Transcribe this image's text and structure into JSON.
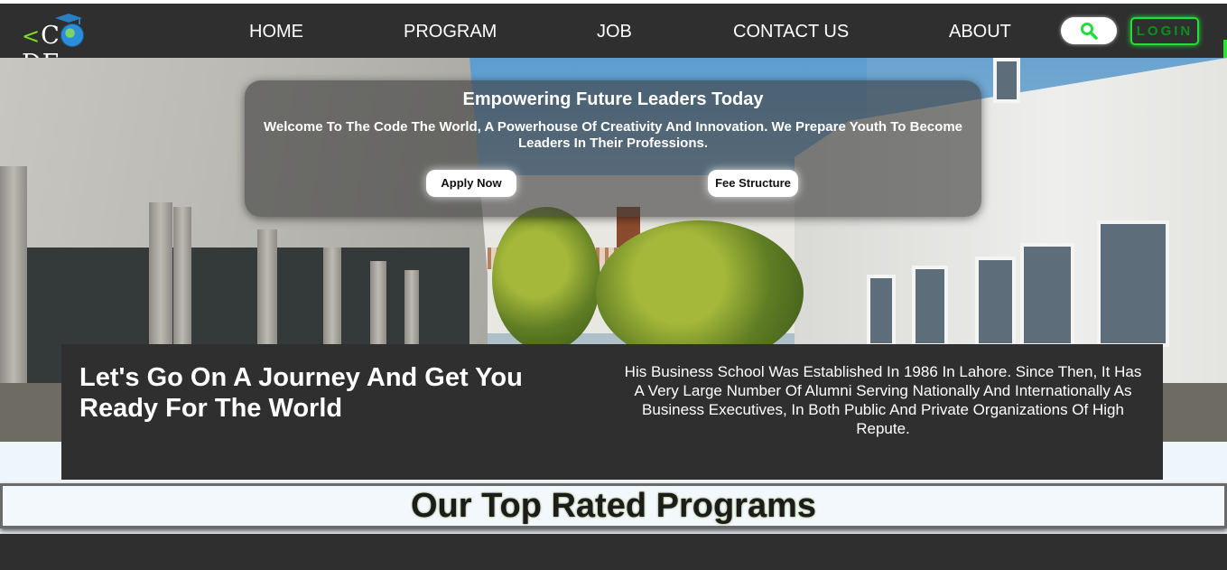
{
  "nav": {
    "logo_text": "CODE",
    "logo_lt": "<",
    "logo_gt": ">",
    "links": [
      "HOME",
      "PROGRAM",
      "JOB",
      "CONTACT US",
      "ABOUT"
    ],
    "search_icon": "search-icon",
    "login_label": "LOGIN",
    "accent_color": "#22dd3a"
  },
  "hero": {
    "title": "Empowering Future Leaders Today",
    "description": "Welcome To The Code The World, A Powerhouse Of Creativity And Innovation. We Prepare Youth To Become Leaders In Their Professions.",
    "apply_label": "Apply Now",
    "fee_label": "Fee Structure"
  },
  "info": {
    "headline": "Let's Go On A Journey And Get You Ready For The World",
    "paragraph": "His Business School Was Established In 1986 In Lahore. Since Then, It Has A Very Large Number Of Alumni Serving Nationally And Internationally As Business Executives, In Both Public And Private Organizations Of High Repute."
  },
  "programs": {
    "title": "Our Top Rated Programs"
  }
}
